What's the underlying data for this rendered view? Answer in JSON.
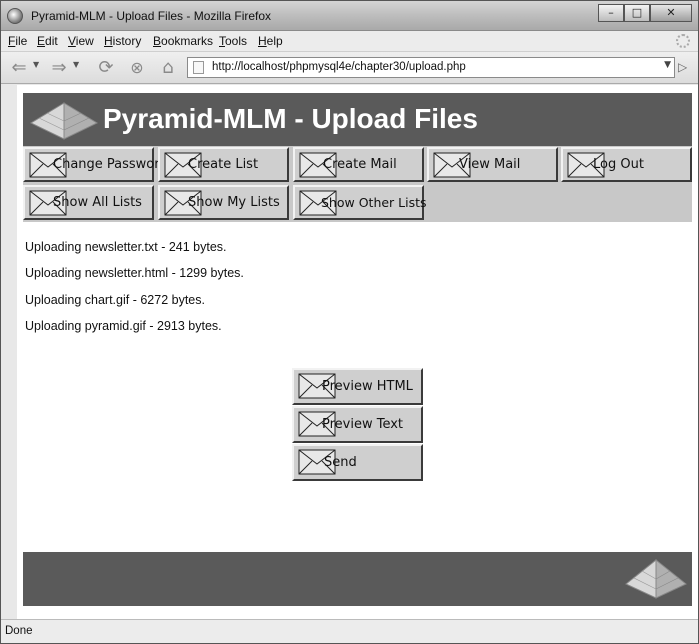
{
  "window": {
    "title": "Pyramid-MLM - Upload Files - Mozilla Firefox"
  },
  "menubar": {
    "items": [
      "File",
      "Edit",
      "View",
      "History",
      "Bookmarks",
      "Tools",
      "Help"
    ]
  },
  "navbar": {
    "url": "http://localhost/phpmysql4e/chapter30/upload.php"
  },
  "page": {
    "title": "Pyramid-MLM - Upload Files",
    "menu": [
      "Change Password",
      "Create List",
      "Create Mail",
      "View Mail",
      "Log Out",
      "Show All Lists",
      "Show My Lists",
      "Show Other Lists"
    ],
    "uploads": [
      "Uploading newsletter.txt - 241 bytes.",
      "Uploading newsletter.html - 1299 bytes.",
      "Uploading chart.gif - 6272 bytes.",
      "Uploading pyramid.gif - 2913 bytes."
    ],
    "actions": [
      "Preview HTML",
      "Preview Text",
      "Send"
    ]
  },
  "statusbar": {
    "text": "Done"
  }
}
